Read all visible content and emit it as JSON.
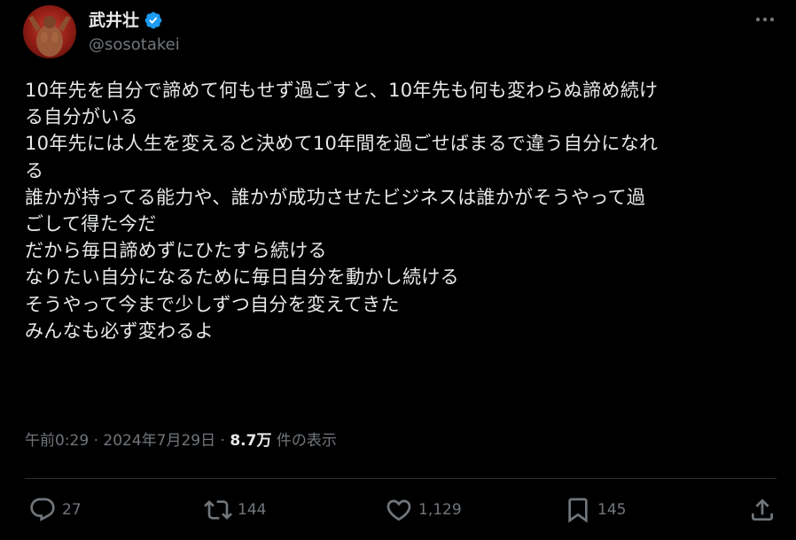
{
  "author": {
    "display_name": "武井壮",
    "handle": "@sosotakei",
    "verified": true
  },
  "tweet": {
    "lines": [
      "10年先を自分で諦めて何もせず過ごすと、10年先も何も変わらぬ諦め続け",
      "る自分がいる",
      "10年先には人生を変えると決めて10年間を過ごせばまるで違う自分になれ",
      "る",
      "誰かが持ってる能力や、誰かが成功させたビジネスは誰かがそうやって過",
      "ごして得た今だ",
      "だから毎日諦めずにひたすら続ける",
      "なりたい自分になるために毎日自分を動かし続ける",
      "そうやって今まで少しずつ自分を変えてきた",
      "みんなも必ず変わるよ"
    ]
  },
  "meta": {
    "time": "午前0:29",
    "separator": " · ",
    "date": "2024年7月29日",
    "views_count": "8.7万",
    "views_label": " 件の表示"
  },
  "actions": {
    "replies": "27",
    "retweets": "144",
    "likes": "1,129",
    "bookmarks": "145"
  },
  "icons": {
    "verified": "verified-badge-icon",
    "more": "more-options-icon",
    "reply": "reply-icon",
    "retweet": "retweet-icon",
    "like": "heart-icon",
    "bookmark": "bookmark-icon",
    "share": "share-icon"
  },
  "colors": {
    "background": "#000000",
    "text_primary": "#e7e9ea",
    "text_secondary": "#71767b",
    "verified_blue": "#1d9bf0",
    "divider": "#2f3336"
  }
}
